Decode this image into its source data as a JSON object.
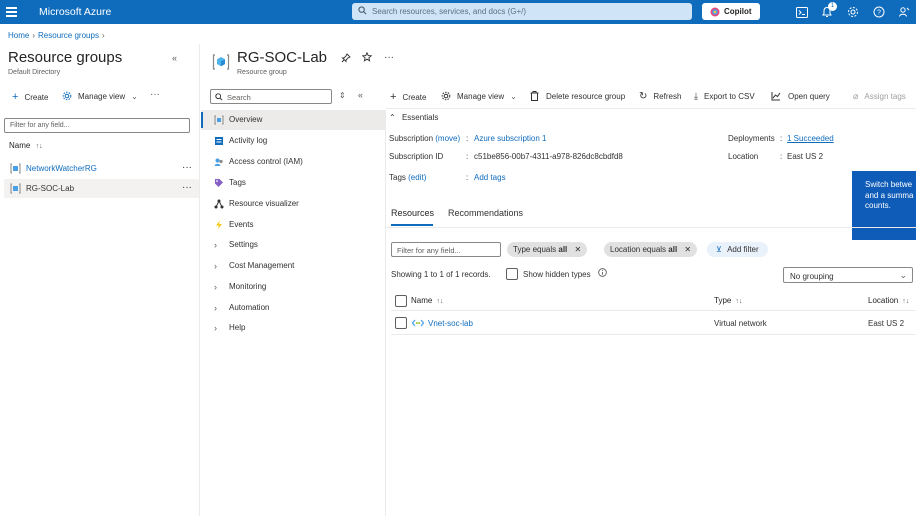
{
  "topbar": {
    "title": "Microsoft Azure",
    "search_placeholder": "Search resources, services, and docs (G+/)",
    "copilot_label": "Copilot",
    "notification_count": "1",
    "icons": [
      "hamburger-icon",
      "search-icon",
      "copilot-icon",
      "cloud-shell-icon",
      "bell-icon",
      "gear-icon",
      "help-icon",
      "feedback-icon"
    ]
  },
  "breadcrumb": {
    "home": "Home",
    "resource_groups": "Resource groups"
  },
  "left_panel": {
    "title": "Resource groups",
    "subtitle": "Default Directory",
    "create": "Create",
    "manage_view": "Manage view",
    "filter_placeholder": "Filter for any field...",
    "column_name": "Name",
    "items": [
      {
        "label": "NetworkWatcherRG",
        "is_link": true
      },
      {
        "label": "RG-SOC-Lab",
        "is_link": false,
        "selected": true
      }
    ]
  },
  "resource": {
    "title": "RG-SOC-Lab",
    "subtitle": "Resource group"
  },
  "menu": {
    "search_placeholder": "Search",
    "items": [
      {
        "label": "Overview",
        "icon": "overview-icon",
        "active": true
      },
      {
        "label": "Activity log",
        "icon": "activity-log-icon"
      },
      {
        "label": "Access control (IAM)",
        "icon": "iam-icon"
      },
      {
        "label": "Tags",
        "icon": "tag-icon"
      },
      {
        "label": "Resource visualizer",
        "icon": "visualizer-icon"
      },
      {
        "label": "Events",
        "icon": "events-icon"
      },
      {
        "label": "Settings",
        "icon": "chevron-right-icon"
      },
      {
        "label": "Cost Management",
        "icon": "chevron-right-icon"
      },
      {
        "label": "Monitoring",
        "icon": "chevron-right-icon"
      },
      {
        "label": "Automation",
        "icon": "chevron-right-icon"
      },
      {
        "label": "Help",
        "icon": "chevron-right-icon"
      }
    ]
  },
  "commands": {
    "create": "Create",
    "manage_view": "Manage view",
    "delete": "Delete resource group",
    "refresh": "Refresh",
    "export": "Export to CSV",
    "open_query": "Open query",
    "assign_tags": "Assign tags"
  },
  "essentials": {
    "header": "Essentials",
    "subscription_label": "Subscription",
    "subscription_move": "(move)",
    "subscription_value": "Azure subscription 1",
    "subscription_id_label": "Subscription ID",
    "subscription_id_value": "c51be856-00b7-4311-a978-826dc8cbdfd8",
    "tags_label": "Tags",
    "tags_edit": "(edit)",
    "tags_value": "Add tags",
    "deployments_label": "Deployments",
    "deployments_value": "1 Succeeded",
    "location_label": "Location",
    "location_value": "East US 2"
  },
  "tooltip": {
    "line1": "Switch betwe",
    "line2": "and a summa",
    "line3": "counts."
  },
  "tabs": {
    "resources": "Resources",
    "recommendations": "Recommendations"
  },
  "filters": {
    "placeholder": "Filter for any field...",
    "type_label": "Type equals",
    "type_value": "all",
    "location_label": "Location equals",
    "location_value": "all",
    "add_filter": "Add filter"
  },
  "list": {
    "showing": "Showing 1 to 1 of 1 records.",
    "show_hidden": "Show hidden types",
    "grouping": "No grouping",
    "columns": {
      "name": "Name",
      "type": "Type",
      "location": "Location"
    },
    "rows": [
      {
        "name": "Vnet-soc-lab",
        "type": "Virtual network",
        "location": "East US 2"
      }
    ]
  },
  "colors": {
    "brand": "#0f6cbd",
    "link": "#0f6cbd",
    "tooltip": "#0f5bb8"
  }
}
